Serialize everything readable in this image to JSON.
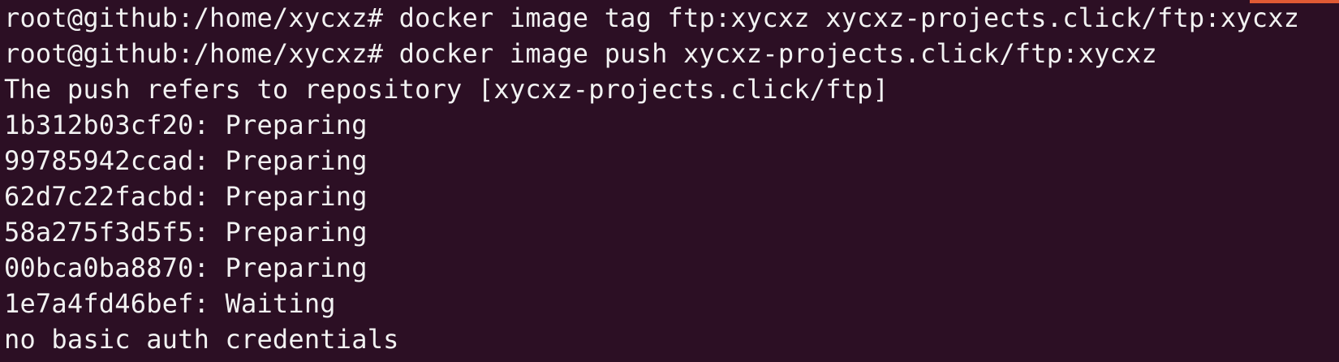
{
  "terminal": {
    "lines": [
      "root@github:/home/xycxz# docker image tag ftp:xycxz xycxz-projects.click/ftp:xycxz",
      "root@github:/home/xycxz# docker image push xycxz-projects.click/ftp:xycxz",
      "The push refers to repository [xycxz-projects.click/ftp]",
      "1b312b03cf20: Preparing",
      "99785942ccad: Preparing",
      "62d7c22facbd: Preparing",
      "58a275f3d5f5: Preparing",
      "00bca0ba8870: Preparing",
      "1e7a4fd46bef: Waiting",
      "no basic auth credentials"
    ]
  },
  "colors": {
    "background": "#2c0f24",
    "text": "#f2f2f2",
    "accent": "#e05a34"
  }
}
